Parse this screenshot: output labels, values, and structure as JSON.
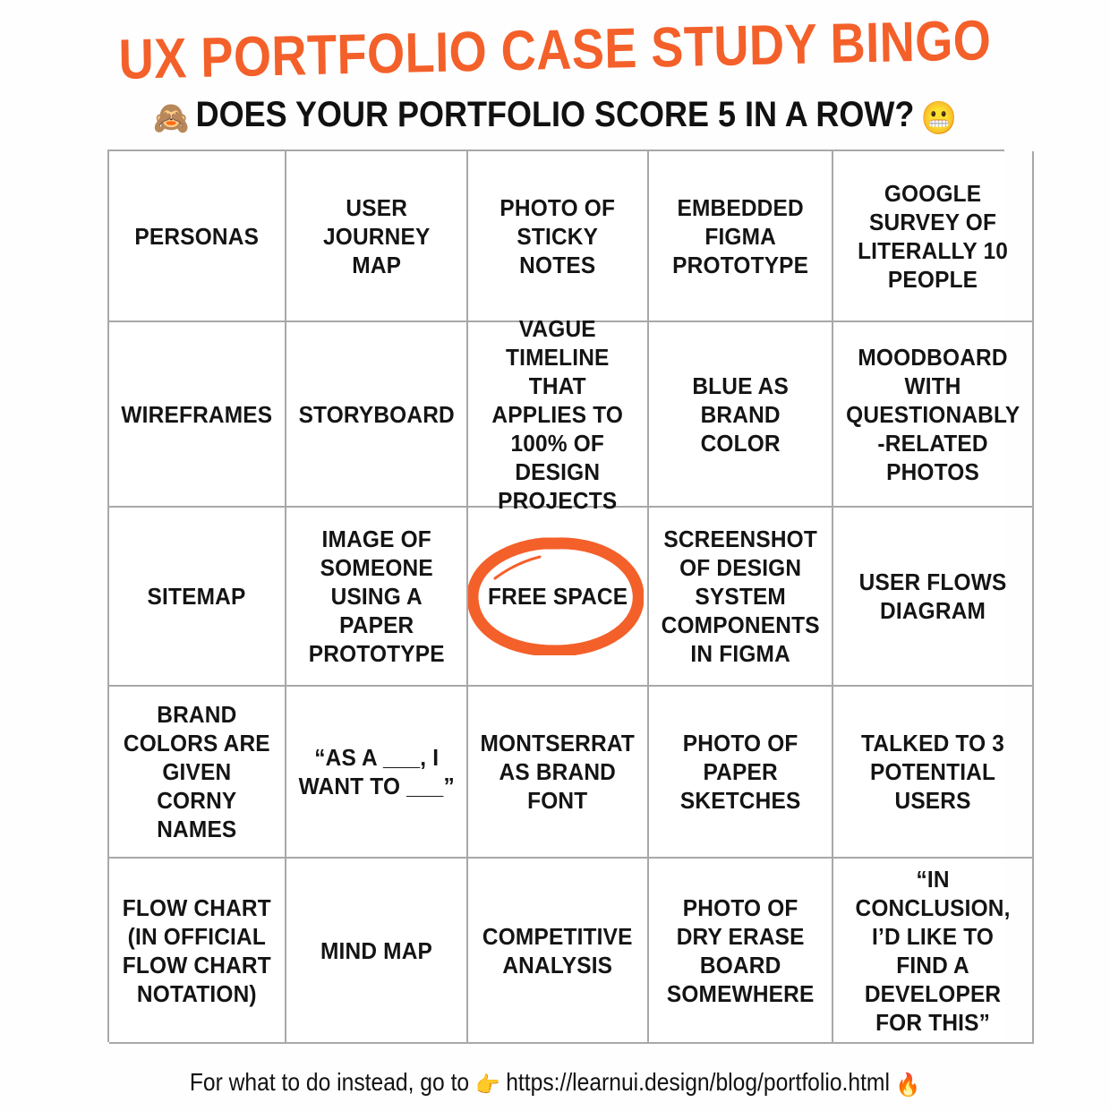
{
  "header": {
    "title": "UX PORTFOLIO CASE STUDY BINGO",
    "subtitle_emoji_left": "🙈",
    "subtitle_text": "DOES YOUR PORTFOLIO SCORE 5 IN A ROW?",
    "subtitle_emoji_right": "😬",
    "title_color": "#F4602A",
    "text_color": "#141414"
  },
  "grid": {
    "rows": 5,
    "columns": 5,
    "border_color": "#a8a8a8",
    "free_space_index": 12,
    "circle_color": "#F4602A",
    "cells": [
      {
        "label": "PERSONAS",
        "marked": false
      },
      {
        "label": "USER JOURNEY MAP",
        "marked": false
      },
      {
        "label": "PHOTO OF STICKY NOTES",
        "marked": false
      },
      {
        "label": "EMBEDDED FIGMA PROTOTYPE",
        "marked": false
      },
      {
        "label": "GOOGLE SURVEY OF LITERALLY 10 PEOPLE",
        "marked": false
      },
      {
        "label": "WIREFRAMES",
        "marked": false
      },
      {
        "label": "STORYBOARD",
        "marked": false
      },
      {
        "label": "VAGUE TIMELINE THAT APPLIES TO 100% OF DESIGN PROJECTS",
        "marked": false
      },
      {
        "label": "BLUE AS BRAND COLOR",
        "marked": false
      },
      {
        "label": "MOODBOARD WITH QUESTIONABLY -RELATED PHOTOS",
        "marked": false
      },
      {
        "label": "SITEMAP",
        "marked": false
      },
      {
        "label": "IMAGE OF SOMEONE USING A PAPER PROTOTYPE",
        "marked": false
      },
      {
        "label": "FREE SPACE",
        "marked": true
      },
      {
        "label": "SCREENSHOT OF DESIGN SYSTEM COMPONENTS IN FIGMA",
        "marked": false
      },
      {
        "label": "USER FLOWS DIAGRAM",
        "marked": false
      },
      {
        "label": "BRAND COLORS ARE GIVEN CORNY NAMES",
        "marked": false
      },
      {
        "label": "“AS A ___, I WANT TO ___”",
        "marked": false
      },
      {
        "label": "MONTSERRAT AS BRAND FONT",
        "marked": false
      },
      {
        "label": "PHOTO OF PAPER SKETCHES",
        "marked": false
      },
      {
        "label": "TALKED TO 3 POTENTIAL USERS",
        "marked": false
      },
      {
        "label": "FLOW CHART (IN OFFICIAL FLOW CHART NOTATION)",
        "marked": false
      },
      {
        "label": "MIND MAP",
        "marked": false
      },
      {
        "label": "COMPETITIVE ANALYSIS",
        "marked": false
      },
      {
        "label": "PHOTO OF DRY ERASE BOARD SOMEWHERE",
        "marked": false
      },
      {
        "label": "“IN CONCLUSION, I’D LIKE TO FIND A DEVELOPER FOR THIS”",
        "marked": false
      }
    ]
  },
  "footer": {
    "text_before": "For what to do instead, go to",
    "emoji_pointer": "👉",
    "url": "https://learnui.design/blog/portfolio.html",
    "emoji_fire": "🔥"
  }
}
